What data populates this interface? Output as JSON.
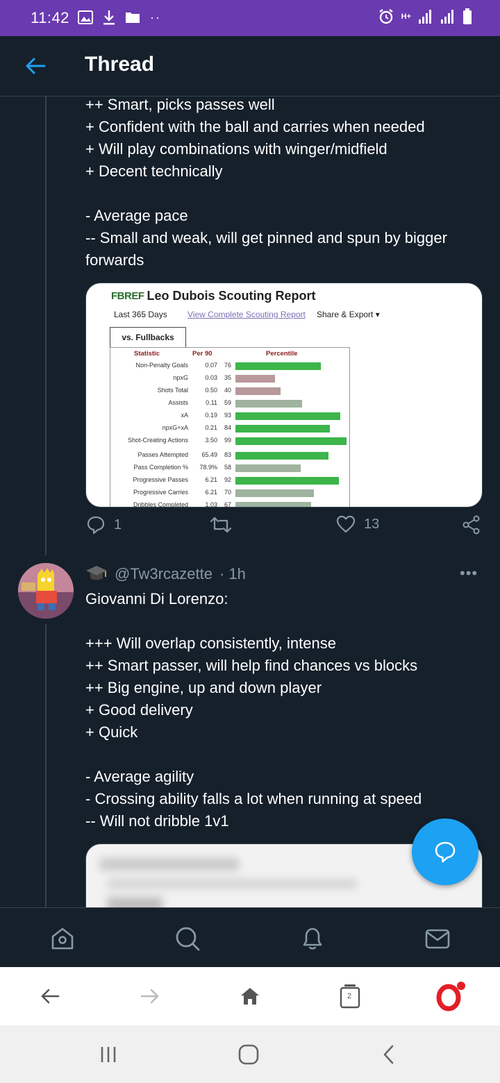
{
  "status_bar": {
    "time": "11:42",
    "dots": "··",
    "network_label": "H+"
  },
  "header": {
    "title": "Thread"
  },
  "tweet1": {
    "text": "++ Smart, picks passes well\n+ Confident with the ball and carries when needed\n+ Will play combinations with winger/midfield\n+ Decent technically\n\n- Average pace\n-- Small and weak, will get pinned and spun by bigger forwards",
    "report": {
      "logo": "FBREF",
      "title": "Leo Dubois Scouting Report",
      "period": "Last 365 Days",
      "link": "View Complete Scouting Report",
      "share": "Share & Export ▾",
      "tab": "vs. Fullbacks",
      "headers": [
        "Statistic",
        "Per 90",
        "Percentile"
      ],
      "rows": [
        {
          "stat": "Non-Penalty Goals",
          "per90": "0.07",
          "pct": 76
        },
        {
          "stat": "npxG",
          "per90": "0.03",
          "pct": 35
        },
        {
          "stat": "Shots Total",
          "per90": "0.50",
          "pct": 40
        },
        {
          "stat": "Assists",
          "per90": "0.11",
          "pct": 59
        },
        {
          "stat": "xA",
          "per90": "0.19",
          "pct": 93
        },
        {
          "stat": "npxG+xA",
          "per90": "0.21",
          "pct": 84
        },
        {
          "stat": "Shot-Creating Actions",
          "per90": "3.50",
          "pct": 99
        },
        {
          "stat": "Passes Attempted",
          "per90": "65.49",
          "pct": 83
        },
        {
          "stat": "Pass Completion %",
          "per90": "78.9%",
          "pct": 58
        },
        {
          "stat": "Progressive Passes",
          "per90": "6.21",
          "pct": 92
        },
        {
          "stat": "Progressive Carries",
          "per90": "6.21",
          "pct": 70
        },
        {
          "stat": "Dribbles Completed",
          "per90": "1.03",
          "pct": 67
        }
      ],
      "colors": {
        "high": "#3cb54a",
        "mid": "#9fb39f",
        "low": "#b8989a"
      }
    },
    "replies": "1",
    "retweets": "",
    "likes": "13"
  },
  "tweet2": {
    "handle": "@Tw3rcazette",
    "time": "· 1h",
    "more": "•••",
    "text": "Giovanni Di Lorenzo:\n\n+++ Will overlap consistently, intense\n++ Smart passer, will help find chances vs blocks\n++ Big engine, up and down player\n+ Good delivery\n+ Quick\n\n- Average agility\n- Crossing ability falls a lot when running at speed\n-- Will not dribble 1v1"
  },
  "bottom_nav": [
    "home-icon",
    "search-icon",
    "bell-icon",
    "mail-icon"
  ],
  "browser_bar": {
    "tabs_count": "2"
  },
  "colors": {
    "background": "#15202b",
    "status_bar": "#6a3ab0",
    "accent": "#1da1f2",
    "muted": "#8899a6",
    "divider": "#38444d"
  }
}
